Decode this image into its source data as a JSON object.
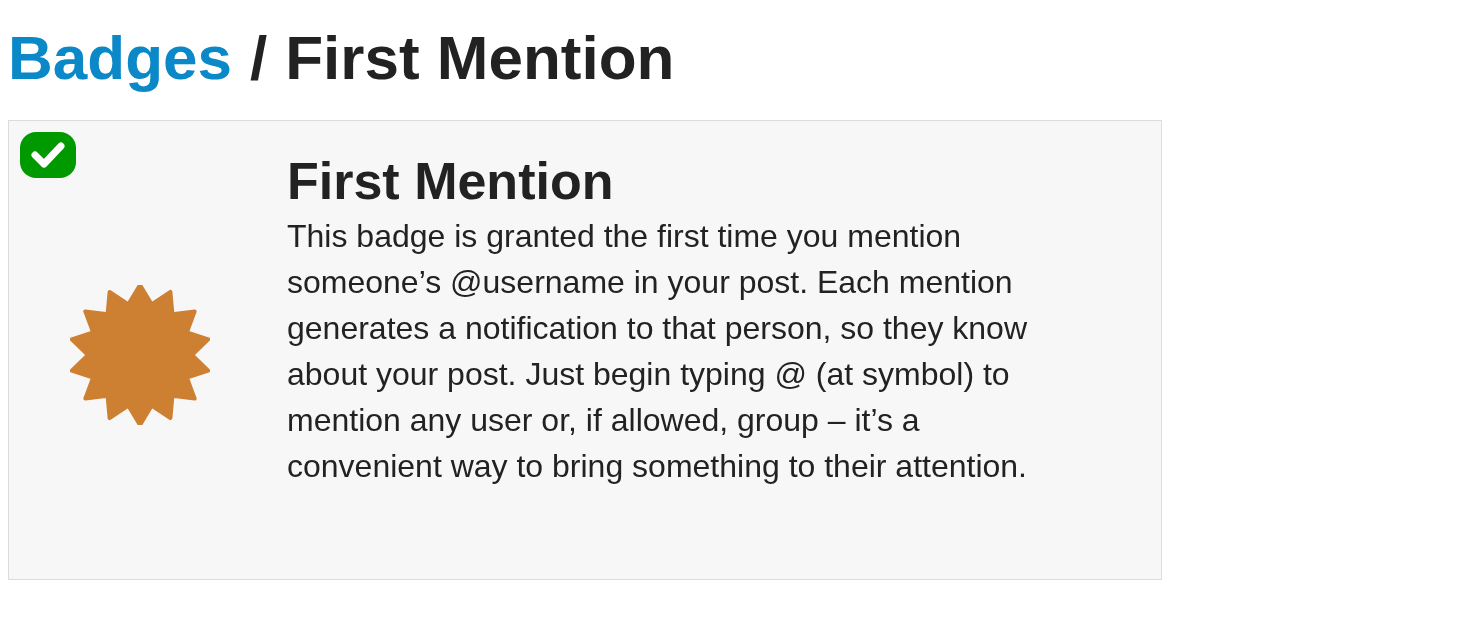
{
  "breadcrumb": {
    "link": "Badges",
    "separator": "/",
    "current": "First Mention"
  },
  "badge": {
    "granted": true,
    "color": "#cd7f32",
    "name": "First Mention",
    "description": "This badge is granted the first time you mention someone’s @username in your post. Each mention generates a notification to that person, so they know about your post. Just begin typing @ (at symbol) to mention any user or, if allowed, group – it’s a convenient way to bring something to their attention."
  }
}
